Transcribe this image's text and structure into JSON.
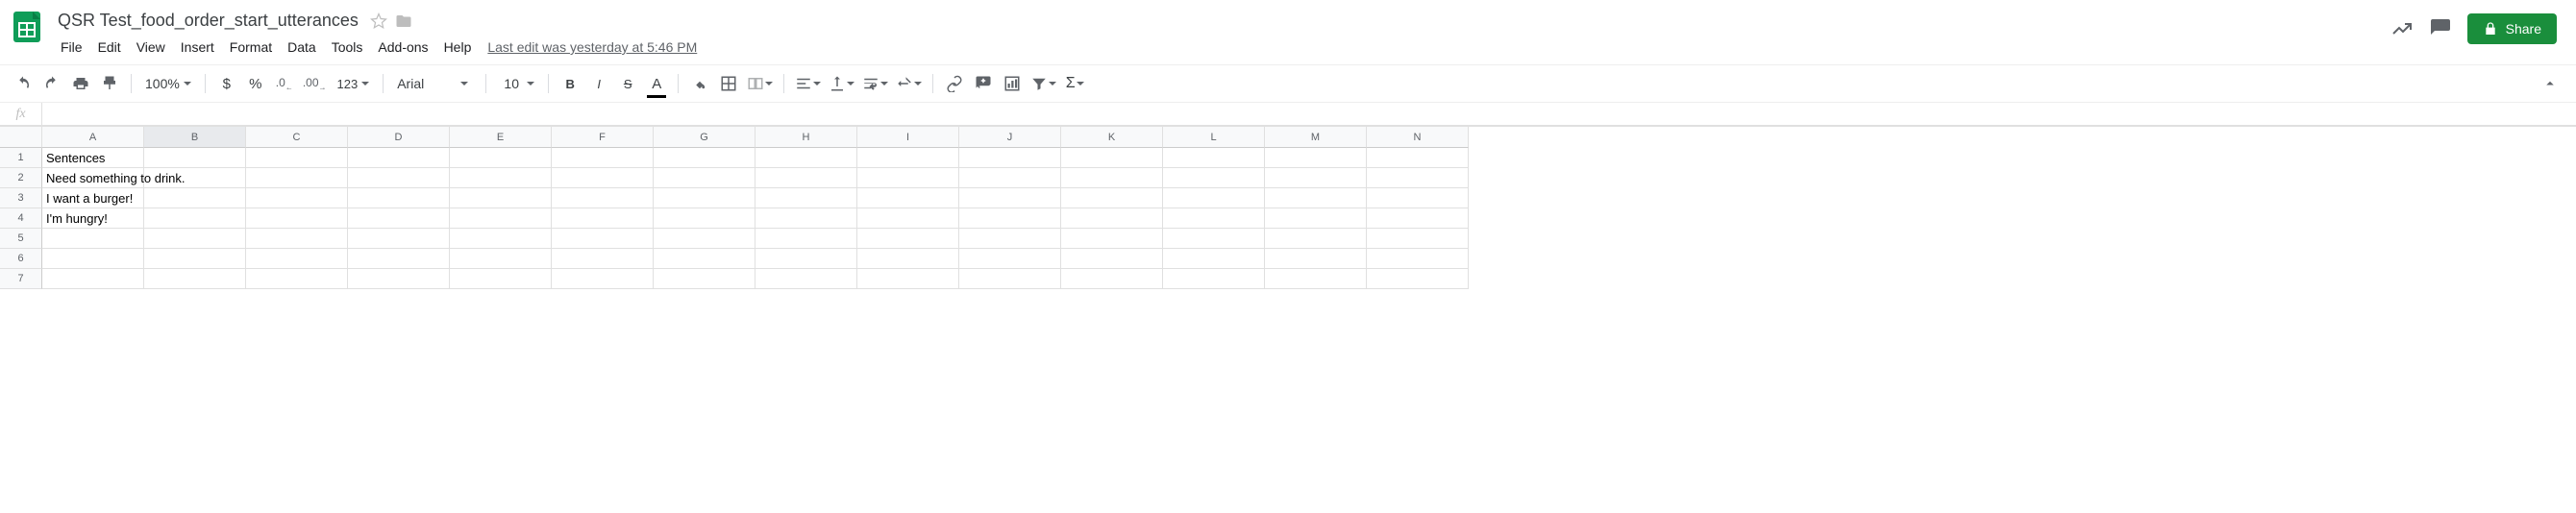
{
  "doc_title": "QSR Test_food_order_start_utterances",
  "menus": [
    "File",
    "Edit",
    "View",
    "Insert",
    "Format",
    "Data",
    "Tools",
    "Add-ons",
    "Help"
  ],
  "last_edit": "Last edit was yesterday at 5:46 PM",
  "share_label": "Share",
  "toolbar": {
    "zoom": "100%",
    "font": "Arial",
    "font_size": "10",
    "more_formats": "123"
  },
  "columns": [
    "A",
    "B",
    "C",
    "D",
    "E",
    "F",
    "G",
    "H",
    "I",
    "J",
    "K",
    "L",
    "M",
    "N"
  ],
  "selected_col": "B",
  "rows": [
    {
      "n": "1",
      "cells": [
        "Sentences",
        "",
        "",
        "",
        "",
        "",
        "",
        "",
        "",
        "",
        "",
        "",
        "",
        ""
      ]
    },
    {
      "n": "2",
      "cells": [
        "Need something to drink.",
        "",
        "",
        "",
        "",
        "",
        "",
        "",
        "",
        "",
        "",
        "",
        "",
        ""
      ]
    },
    {
      "n": "3",
      "cells": [
        "I want a burger!",
        "",
        "",
        "",
        "",
        "",
        "",
        "",
        "",
        "",
        "",
        "",
        "",
        ""
      ]
    },
    {
      "n": "4",
      "cells": [
        "I'm hungry!",
        "",
        "",
        "",
        "",
        "",
        "",
        "",
        "",
        "",
        "",
        "",
        "",
        ""
      ]
    },
    {
      "n": "5",
      "cells": [
        "",
        "",
        "",
        "",
        "",
        "",
        "",
        "",
        "",
        "",
        "",
        "",
        "",
        ""
      ]
    },
    {
      "n": "6",
      "cells": [
        "",
        "",
        "",
        "",
        "",
        "",
        "",
        "",
        "",
        "",
        "",
        "",
        "",
        ""
      ]
    },
    {
      "n": "7",
      "cells": [
        "",
        "",
        "",
        "",
        "",
        "",
        "",
        "",
        "",
        "",
        "",
        "",
        "",
        ""
      ]
    }
  ],
  "fx_value": ""
}
